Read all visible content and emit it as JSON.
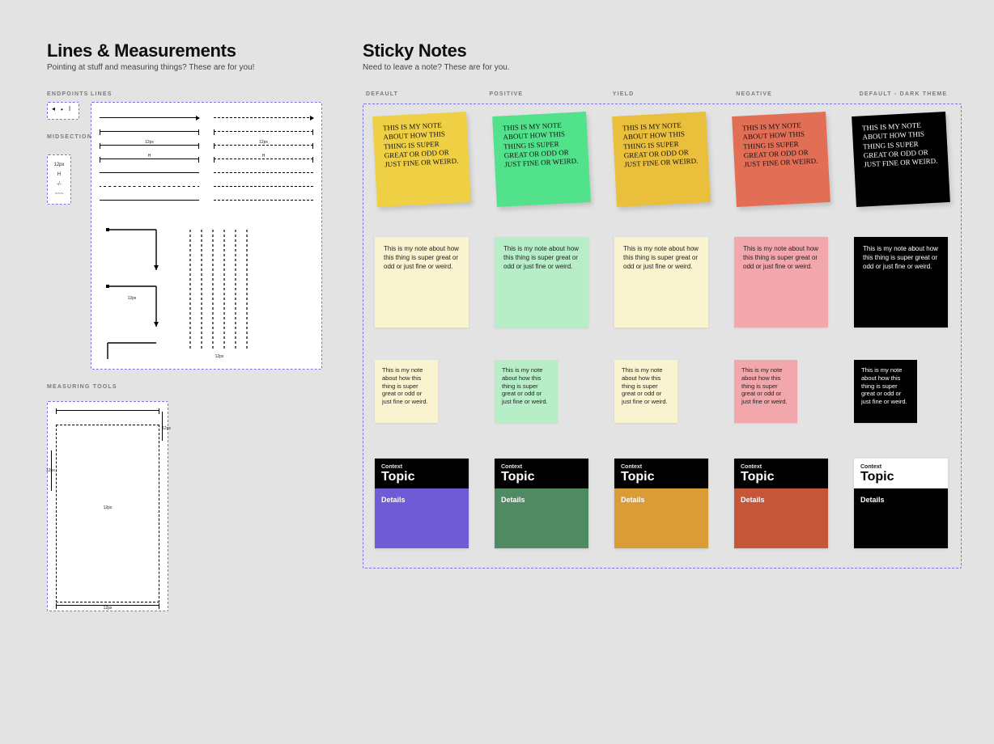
{
  "lines_section": {
    "title": "Lines & Measurements",
    "subtitle": "Pointing at stuff and measuring things? These are for you!",
    "labels": {
      "endpoints": "ENDPOINTS",
      "midsections": "MIDSECTIONS",
      "lines": "LINES",
      "measuring_tools": "MEASURING TOOLS"
    },
    "midsections": {
      "r0": "12px",
      "r1": "H",
      "r2": "-/-",
      "r3": "~~~"
    },
    "sample_dim": "12px"
  },
  "sticky_section": {
    "title": "Sticky Notes",
    "subtitle": "Need to leave a note? These are for you.",
    "groups": [
      "DEFAULT",
      "POSITIVE",
      "YIELD",
      "NEGATIVE",
      "DEFAULT - DARK THEME"
    ],
    "note_text_hand": "THIS IS MY NOTE ABOUT HOW THIS THING IS SUPER GREAT OR ODD OR JUST FINE OR WEIRD.",
    "note_text_plain": "This is my note about how this thing is super great or odd or just fine or weird.",
    "colors": {
      "tilt": [
        "#efd044",
        "#53e28c",
        "#eabf3c",
        "#e26e56",
        "#000000"
      ],
      "flat": [
        "#faf3cf",
        "#b7eec7",
        "#faf3cf",
        "#f1a7ab",
        "#000000"
      ],
      "small": [
        "#faf3cf",
        "#b7eec7",
        "#faf3cf",
        "#f1a7ab",
        "#000000"
      ]
    },
    "cards": {
      "context": "Context",
      "topic": "Topic",
      "details": "Details",
      "body_colors": [
        "#6f5bd6",
        "#4f8a62",
        "#d99c37",
        "#c6563a",
        "#000000"
      ],
      "inverse_header_index": 4
    }
  }
}
